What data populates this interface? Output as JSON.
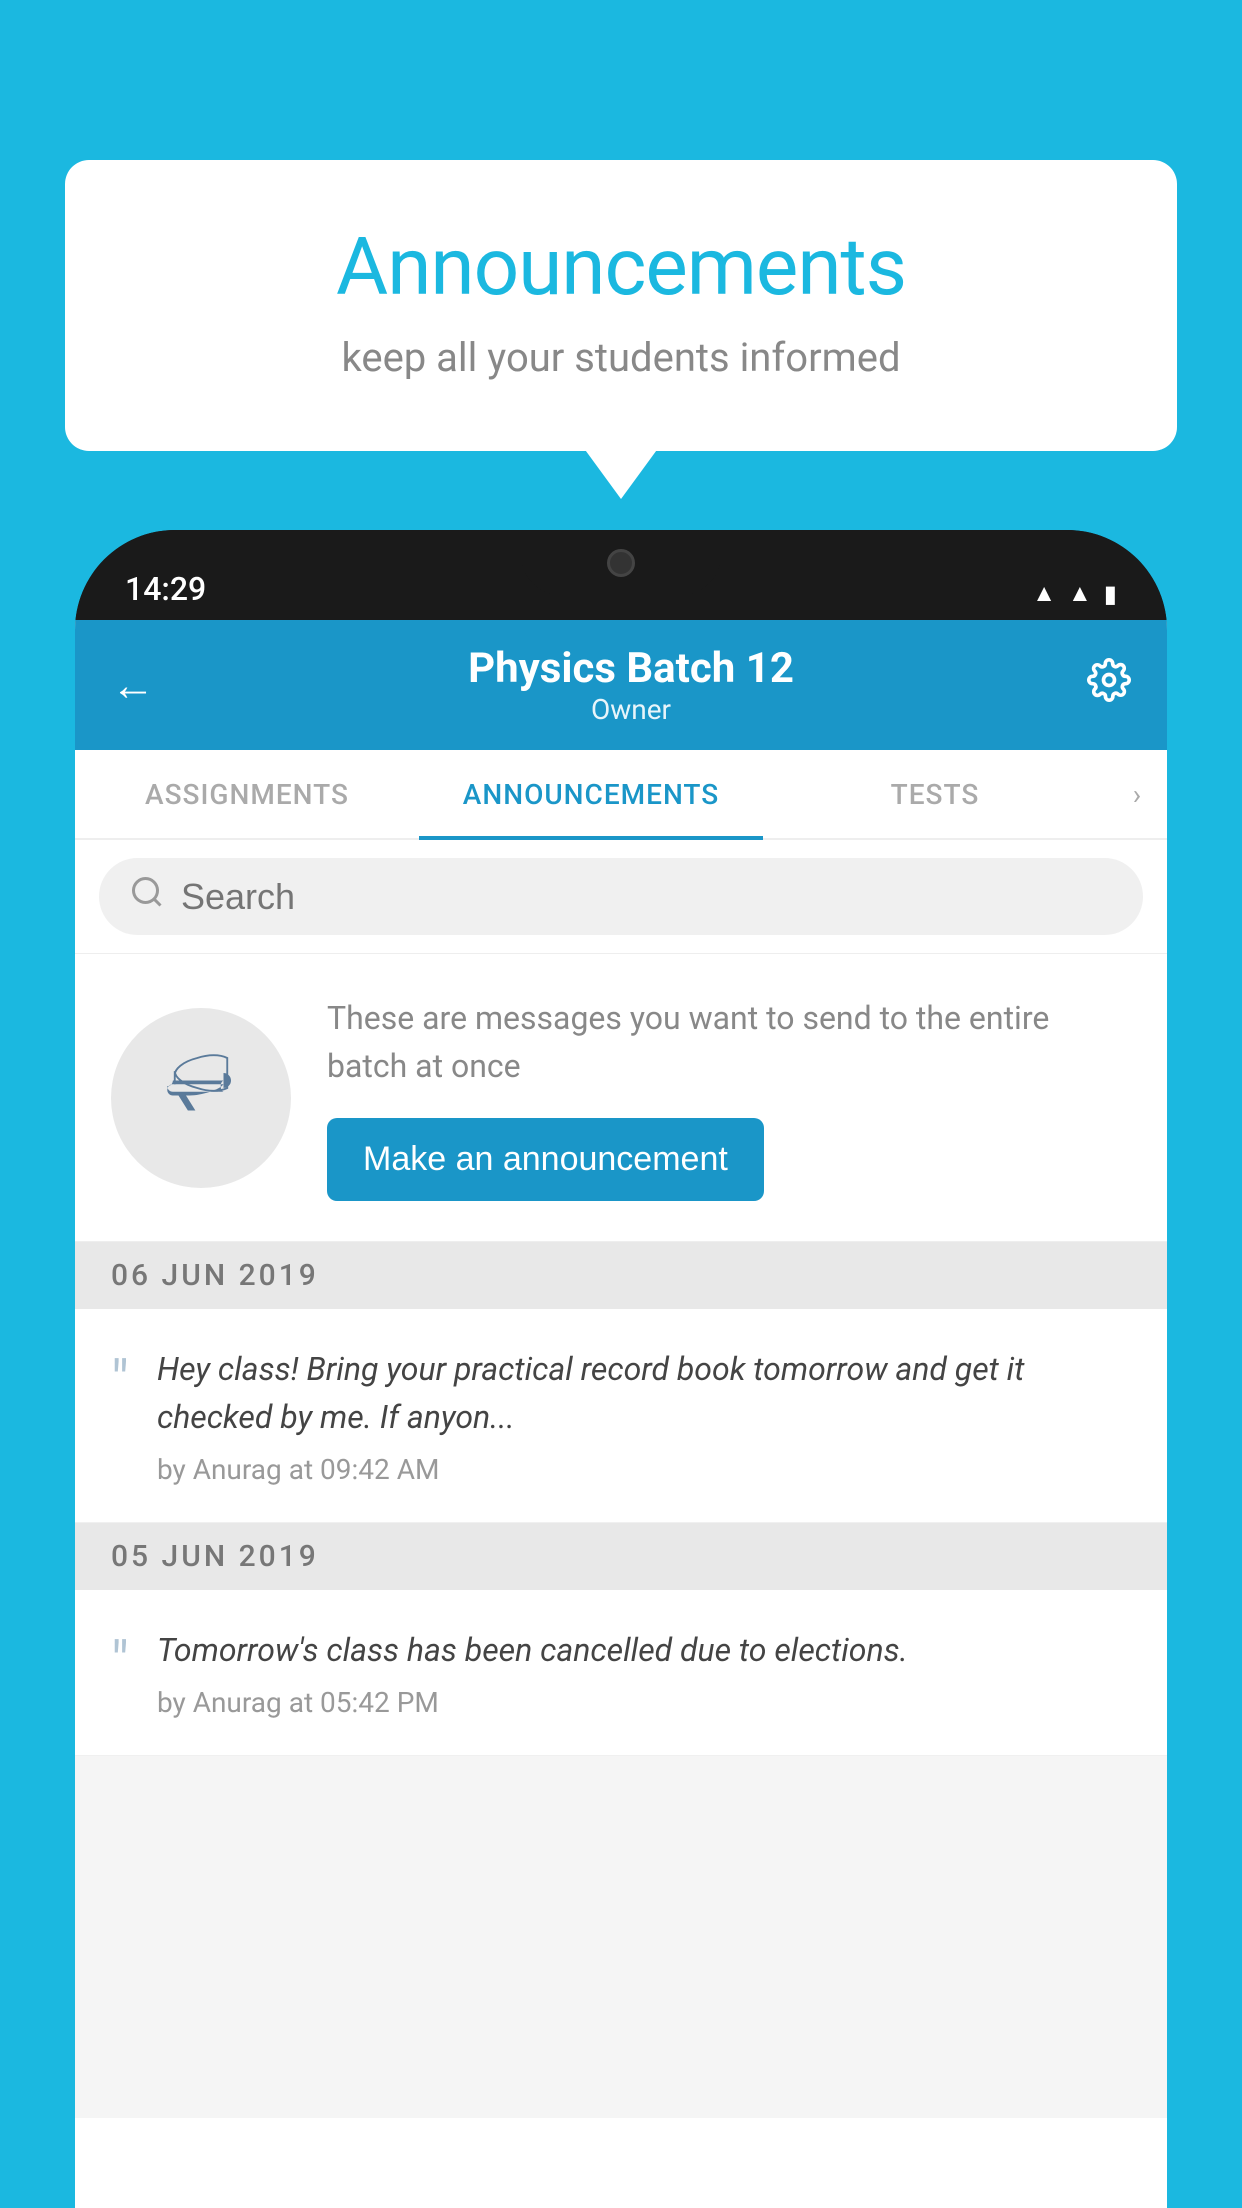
{
  "background_color": "#1BB8E0",
  "speech_bubble": {
    "title": "Announcements",
    "subtitle": "keep all your students informed"
  },
  "phone": {
    "status_bar": {
      "time": "14:29",
      "icons": [
        "wifi",
        "signal",
        "battery"
      ]
    },
    "app_bar": {
      "title": "Physics Batch 12",
      "subtitle": "Owner",
      "back_label": "←",
      "settings_label": "⚙"
    },
    "tabs": [
      {
        "label": "ASSIGNMENTS",
        "active": false
      },
      {
        "label": "ANNOUNCEMENTS",
        "active": true
      },
      {
        "label": "TESTS",
        "active": false
      }
    ],
    "search": {
      "placeholder": "Search"
    },
    "promo": {
      "description": "These are messages you want to send to the entire batch at once",
      "button_label": "Make an announcement"
    },
    "announcements": [
      {
        "date": "06  JUN  2019",
        "text": "Hey class! Bring your practical record book tomorrow and get it checked by me. If anyon...",
        "meta": "by Anurag at 09:42 AM"
      },
      {
        "date": "05  JUN  2019",
        "text": "Tomorrow's class has been cancelled due to elections.",
        "meta": "by Anurag at 05:42 PM"
      }
    ]
  }
}
